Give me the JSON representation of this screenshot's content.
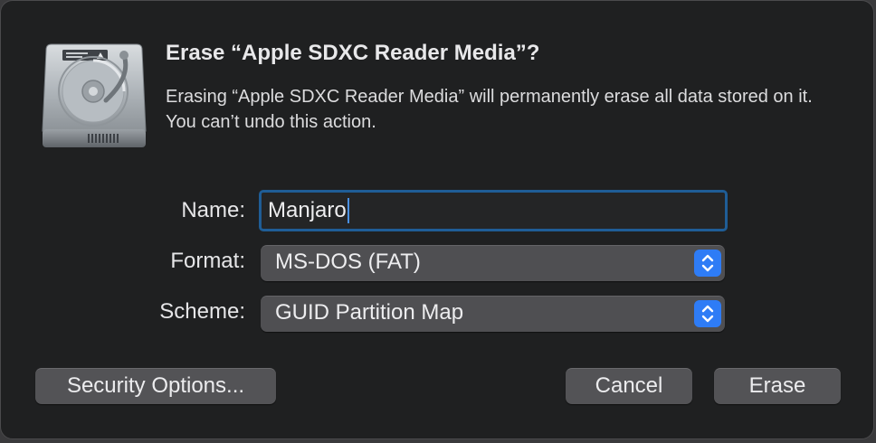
{
  "dialog": {
    "title": "Erase “Apple SDXC Reader Media”?",
    "message": "Erasing “Apple SDXC Reader Media” will permanently erase all data stored on it. You can’t undo this action.",
    "icon": "internal-disk-icon"
  },
  "form": {
    "name": {
      "label": "Name:",
      "value": "Manjaro"
    },
    "format": {
      "label": "Format:",
      "selected": "MS-DOS (FAT)"
    },
    "scheme": {
      "label": "Scheme:",
      "selected": "GUID Partition Map"
    }
  },
  "buttons": {
    "security_options": "Security Options...",
    "cancel": "Cancel",
    "erase": "Erase"
  },
  "colors": {
    "dialog_background": "#1f2021",
    "focus_ring": "#1f5d96",
    "accent": "#2e7cf6",
    "button": "#535356"
  }
}
